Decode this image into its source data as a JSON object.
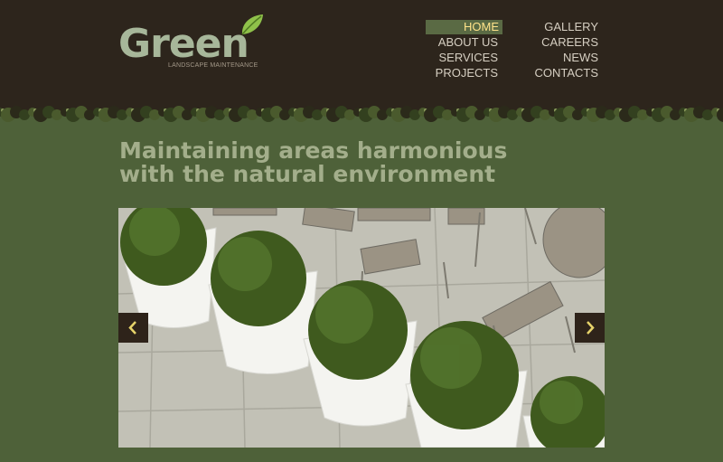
{
  "brand": {
    "name": "Green",
    "tagline": "LANDSCAPE MAINTENANCE"
  },
  "nav": {
    "left": [
      {
        "label": "HOME",
        "active": true
      },
      {
        "label": "ABOUT US"
      },
      {
        "label": "SERVICES"
      },
      {
        "label": "PROJECTS"
      }
    ],
    "right": [
      {
        "label": "GALLERY"
      },
      {
        "label": "CAREERS"
      },
      {
        "label": "NEWS"
      },
      {
        "label": "CONTACTS"
      }
    ]
  },
  "hero": {
    "headline_line1": "Maintaining areas harmonious",
    "headline_line2": "with the natural environment"
  },
  "slider": {
    "image": "potted-topiary-hedges-patio",
    "prev_icon": "chevron-left-icon",
    "next_icon": "chevron-right-icon"
  },
  "colors": {
    "header_bg": "#2d251c",
    "page_bg": "#4e6139",
    "accent": "#ffe38a",
    "headline": "#a3ae8b",
    "logo": "#a7b79a"
  }
}
